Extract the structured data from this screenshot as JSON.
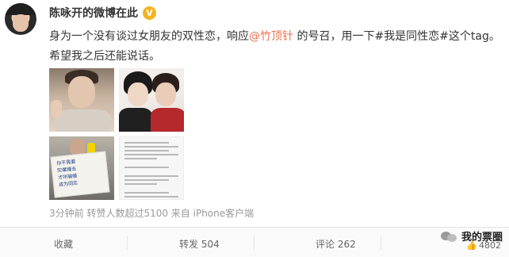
{
  "user": {
    "name": "陈咏开的微博在此",
    "verified_icon": "verified-badge-icon",
    "verified_mark": "V",
    "verified_color": "#f3b320"
  },
  "post": {
    "line1_prefix": "身为一个没有谈过女朋友的双性恋，响应",
    "mention": "@竹顶针",
    "line1_suffix": " 的号召，用一下",
    "hashtag1": "#我是同性恋#",
    "line1_end": "这个tag。",
    "line2": "希望我之后还能说话。",
    "mention_color": "#eb7350"
  },
  "photos": {
    "sign_lines": [
      "你不需要",
      "陀螺撞去",
      "才所骗婚",
      "成为同志"
    ]
  },
  "meta": {
    "text": "3分钟前 转赞人数超过5100 来自 iPhone客户端"
  },
  "actions": {
    "favorite": "收藏",
    "repost": "转发 504",
    "comment": "评论 262",
    "like": "4802"
  },
  "watermark": {
    "text": "我的票圈",
    "icon": "wechat-icon"
  }
}
